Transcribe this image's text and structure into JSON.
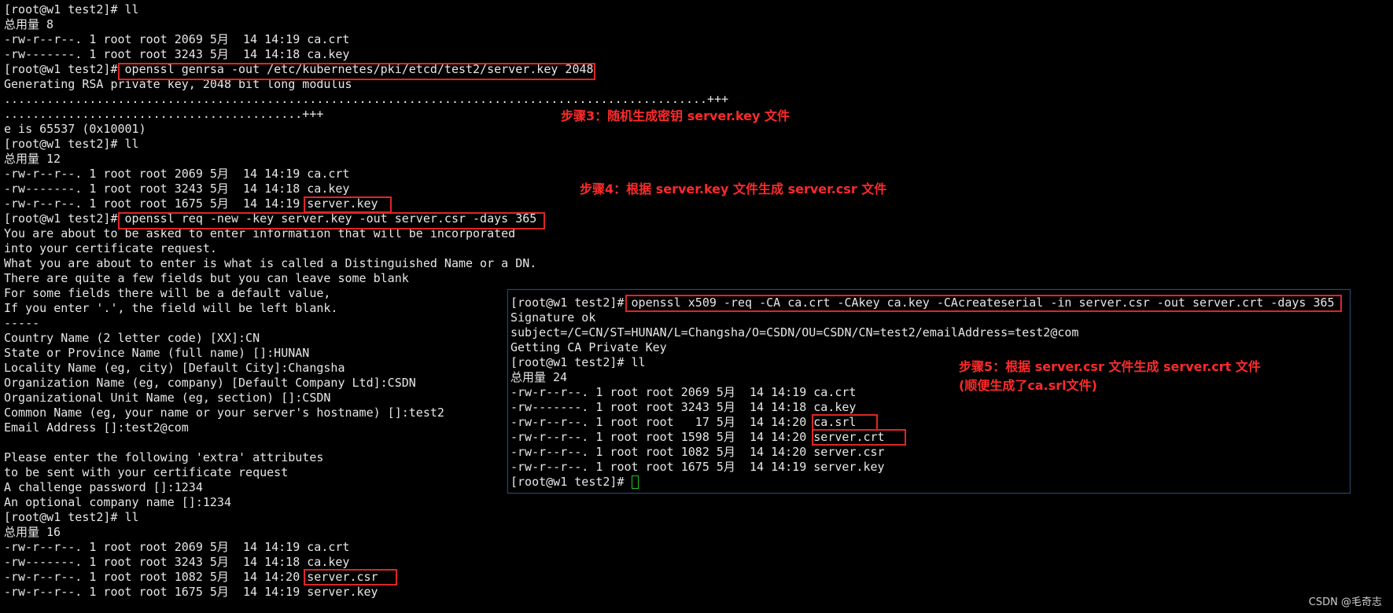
{
  "terminal": {
    "lines": [
      "[root@w1 test2]# ll",
      "总用量 8",
      "-rw-r--r--. 1 root root 2069 5月  14 14:19 ca.crt",
      "-rw-------. 1 root root 3243 5月  14 14:18 ca.key",
      "[root@w1 test2]# openssl genrsa -out /etc/kubernetes/pki/etcd/test2/server.key 2048",
      "Generating RSA private key, 2048 bit long modulus",
      "...................................................................................................+++",
      "..........................................+++",
      "e is 65537 (0x10001)",
      "[root@w1 test2]# ll",
      "总用量 12",
      "-rw-r--r--. 1 root root 2069 5月  14 14:19 ca.crt",
      "-rw-------. 1 root root 3243 5月  14 14:18 ca.key",
      "-rw-r--r--. 1 root root 1675 5月  14 14:19 server.key",
      "[root@w1 test2]# openssl req -new -key server.key -out server.csr -days 365",
      "You are about to be asked to enter information that will be incorporated",
      "into your certificate request.",
      "What you are about to enter is what is called a Distinguished Name or a DN.",
      "There are quite a few fields but you can leave some blank",
      "For some fields there will be a default value,",
      "If you enter '.', the field will be left blank.",
      "-----",
      "Country Name (2 letter code) [XX]:CN",
      "State or Province Name (full name) []:HUNAN",
      "Locality Name (eg, city) [Default City]:Changsha",
      "Organization Name (eg, company) [Default Company Ltd]:CSDN",
      "Organizational Unit Name (eg, section) []:CSDN",
      "Common Name (eg, your name or your server's hostname) []:test2",
      "Email Address []:test2@com",
      "",
      "Please enter the following 'extra' attributes",
      "to be sent with your certificate request",
      "A challenge password []:1234",
      "An optional company name []:1234",
      "[root@w1 test2]# ll",
      "总用量 16",
      "-rw-r--r--. 1 root root 2069 5月  14 14:19 ca.crt",
      "-rw-------. 1 root root 3243 5月  14 14:18 ca.key",
      "-rw-r--r--. 1 root root 1082 5月  14 14:20 server.csr",
      "-rw-r--r--. 1 root root 1675 5月  14 14:19 server.key"
    ]
  },
  "overlay": {
    "lines": [
      "[root@w1 test2]# openssl x509 -req -CA ca.crt -CAkey ca.key -CAcreateserial -in server.csr -out server.crt -days 365",
      "Signature ok",
      "subject=/C=CN/ST=HUNAN/L=Changsha/O=CSDN/OU=CSDN/CN=test2/emailAddress=test2@com",
      "Getting CA Private Key",
      "[root@w1 test2]# ll",
      "总用量 24",
      "-rw-r--r--. 1 root root 2069 5月  14 14:19 ca.crt",
      "-rw-------. 1 root root 3243 5月  14 14:18 ca.key",
      "-rw-r--r--. 1 root root   17 5月  14 14:20 ca.srl",
      "-rw-r--r--. 1 root root 1598 5月  14 14:20 server.crt",
      "-rw-r--r--. 1 root root 1082 5月  14 14:20 server.csr",
      "-rw-r--r--. 1 root root 1675 5月  14 14:19 server.key",
      "[root@w1 test2]# "
    ]
  },
  "annotations": {
    "step3": "步骤3：随机生成密钥 server.key 文件",
    "step4": "步骤4：根据 server.key 文件生成 server.csr 文件",
    "step5_line1": "步骤5：根据 server.csr 文件生成 server.crt 文件",
    "step5_line2": "(顺便生成了ca.srl文件)"
  },
  "watermark": "CSDN @毛奇志",
  "colors": {
    "background": "#000000",
    "text": "#e6e6e6",
    "highlight": "#e02525",
    "annotation": "#ff2a2a",
    "cursor": "#22c322"
  }
}
